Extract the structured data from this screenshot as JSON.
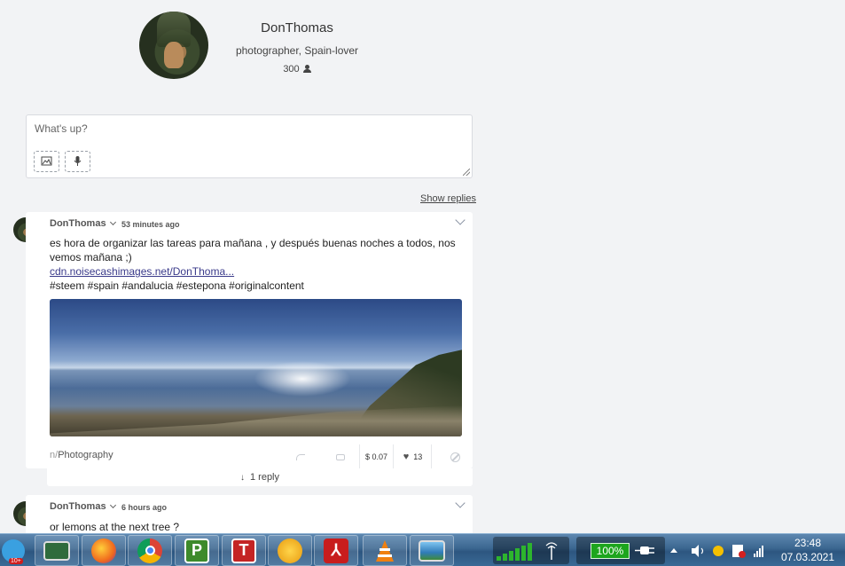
{
  "profile": {
    "name": "DonThomas",
    "bio": "photographer, Spain-lover",
    "followers": "300"
  },
  "composer": {
    "placeholder": "What's up?"
  },
  "show_replies_label": "Show replies",
  "posts": [
    {
      "author": "DonThomas",
      "time": "53 minutes ago",
      "text_line1": "es hora de organizar las tareas para mañana , y después buenas noches a todos, nos",
      "text_line2": "vemos mañana ;)",
      "link": "cdn.noisecashimages.net/DonThoma...",
      "tags": "#steem #spain #andalucia #estepona #originalcontent",
      "category_prefix": "n/",
      "category": "Photography",
      "tip": "$ 0.07",
      "likes": "13",
      "replies_label": "1 reply"
    },
    {
      "author": "DonThomas",
      "time": "6 hours ago",
      "text_line1": "or lemons at the next tree ?"
    }
  ],
  "taskbar": {
    "battery": "100%",
    "time": "23:48",
    "date": "07.03.2021",
    "notification_badge": "10+"
  }
}
